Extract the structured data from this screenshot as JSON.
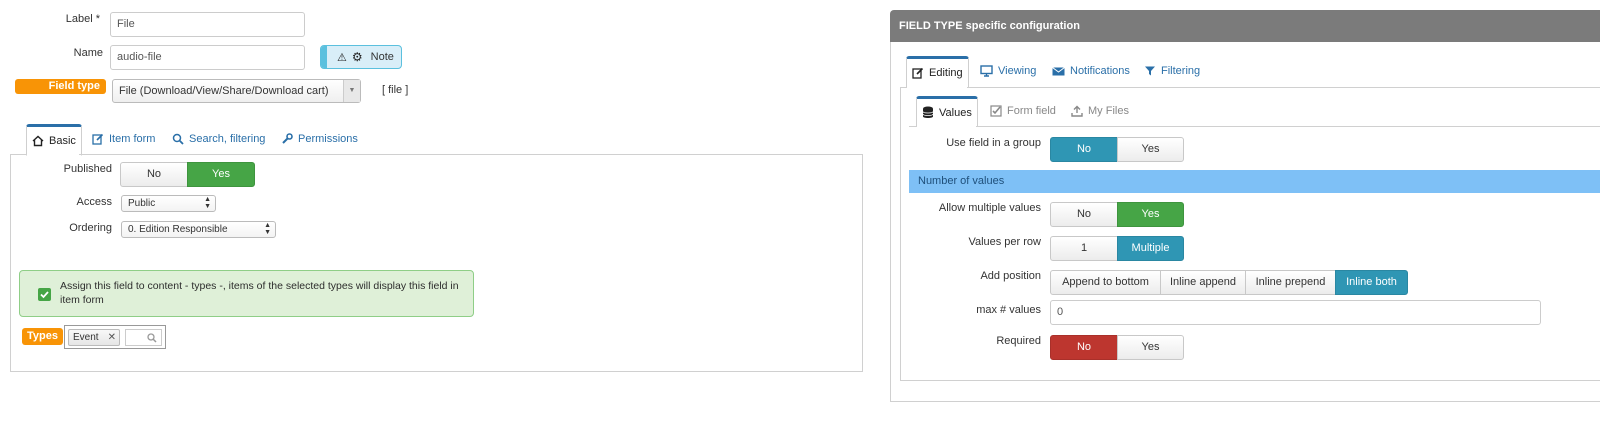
{
  "left": {
    "label_field": {
      "label": "Label *",
      "value": "File"
    },
    "name_field": {
      "label": "Name",
      "value": "audio-file"
    },
    "note_button": {
      "label": "Note"
    },
    "field_type": {
      "label": "Field type",
      "value": "File (Download/View/Share/Download cart)",
      "tag": "[ file ]"
    },
    "tabs": [
      {
        "label": "Basic",
        "icon": "home-icon"
      },
      {
        "label": "Item form",
        "icon": "edit-icon"
      },
      {
        "label": "Search, filtering",
        "icon": "search-icon"
      },
      {
        "label": "Permissions",
        "icon": "wrench-icon"
      }
    ],
    "published": {
      "label": "Published",
      "options": [
        "No",
        "Yes"
      ],
      "selected": "Yes"
    },
    "access": {
      "label": "Access",
      "value": "Public"
    },
    "ordering": {
      "label": "Ordering",
      "value": "0. Edition Responsible"
    },
    "assign_notice": "Assign this field to content - types -, items of the selected types will display this field in item form",
    "types": {
      "label": "Types",
      "chips": [
        "Event"
      ]
    }
  },
  "right": {
    "header": "FIELD TYPE specific configuration",
    "tabs": [
      {
        "label": "Editing",
        "icon": "edit-icon"
      },
      {
        "label": "Viewing",
        "icon": "monitor-icon"
      },
      {
        "label": "Notifications",
        "icon": "envelope-icon"
      },
      {
        "label": "Filtering",
        "icon": "filter-icon"
      }
    ],
    "subtabs": [
      {
        "label": "Values",
        "icon": "database-icon"
      },
      {
        "label": "Form field",
        "icon": "checkbox-icon"
      },
      {
        "label": "My Files",
        "icon": "upload-icon"
      }
    ],
    "use_group": {
      "label": "Use field in a group",
      "options": [
        "No",
        "Yes"
      ],
      "selected": "No"
    },
    "section_number": "Number of values",
    "allow_multiple": {
      "label": "Allow multiple values",
      "options": [
        "No",
        "Yes"
      ],
      "selected": "Yes"
    },
    "values_per_row": {
      "label": "Values per row",
      "options": [
        "1",
        "Multiple"
      ],
      "selected": "Multiple"
    },
    "add_position": {
      "label": "Add position",
      "options": [
        "Append to bottom",
        "Inline append",
        "Inline prepend",
        "Inline both"
      ],
      "selected": "Inline both"
    },
    "max_values": {
      "label": "max # values",
      "value": "0"
    },
    "required": {
      "label": "Required",
      "options": [
        "No",
        "Yes"
      ],
      "selected": "No"
    }
  },
  "colors": {
    "link": "#2a6fa8",
    "orange": "#f89406",
    "green": "#46a546",
    "blue": "#2f96b4",
    "red": "#bd362f",
    "light_blue": "#7ec0f6",
    "header_gray": "#7b7b7b"
  }
}
